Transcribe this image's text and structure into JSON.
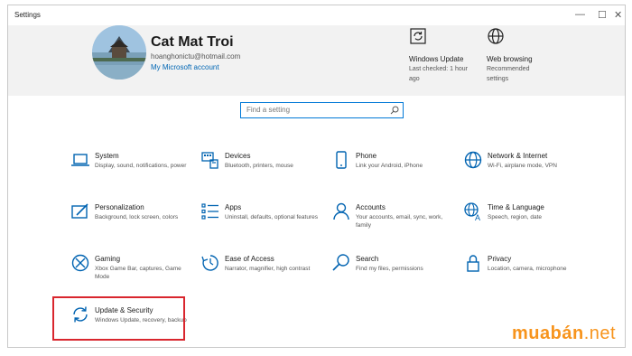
{
  "window": {
    "title": "Settings",
    "minimize": "—",
    "maximize": "☐",
    "close": "✕"
  },
  "account": {
    "name": "Cat Mat Troi",
    "email": "hoanghonictu@hotmail.com",
    "link": "My Microsoft account"
  },
  "header_items": [
    {
      "label": "Windows Update",
      "sub1": "Last checked: 1 hour",
      "sub2": "ago",
      "icon": "sync-icon"
    },
    {
      "label": "Web browsing",
      "sub1": "Recommended",
      "sub2": "settings",
      "icon": "globe-icon"
    }
  ],
  "search": {
    "placeholder": "Find a setting"
  },
  "tiles": [
    {
      "title": "System",
      "desc": "Display, sound, notifications, power",
      "icon": "laptop-icon"
    },
    {
      "title": "Devices",
      "desc": "Bluetooth, printers, mouse",
      "icon": "keyboard-icon"
    },
    {
      "title": "Phone",
      "desc": "Link your Android, iPhone",
      "icon": "phone-icon"
    },
    {
      "title": "Network & Internet",
      "desc": "Wi-Fi, airplane mode, VPN",
      "icon": "globe-icon"
    },
    {
      "title": "Personalization",
      "desc": "Background, lock screen, colors",
      "icon": "paint-icon"
    },
    {
      "title": "Apps",
      "desc": "Uninstall, defaults, optional features",
      "icon": "apps-list-icon"
    },
    {
      "title": "Accounts",
      "desc": "Your accounts, email, sync, work, family",
      "icon": "person-icon"
    },
    {
      "title": "Time & Language",
      "desc": "Speech, region, date",
      "icon": "time-language-icon"
    },
    {
      "title": "Gaming",
      "desc": "Xbox Game Bar, captures, Game Mode",
      "icon": "xbox-icon"
    },
    {
      "title": "Ease of Access",
      "desc": "Narrator, magnifier, high contrast",
      "icon": "ease-of-access-icon"
    },
    {
      "title": "Search",
      "desc": "Find my files, permissions",
      "icon": "search-icon"
    },
    {
      "title": "Privacy",
      "desc": "Location, camera, microphone",
      "icon": "lock-icon"
    },
    {
      "title": "Update & Security",
      "desc": "Windows Update, recovery, backup",
      "icon": "sync-icon"
    }
  ],
  "watermark": {
    "text": "muabán",
    "suffix": ".net"
  },
  "colors": {
    "accent": "#0078d7",
    "icon": "#0063b1",
    "highlight": "#d9262e",
    "watermark": "#f7941d"
  }
}
